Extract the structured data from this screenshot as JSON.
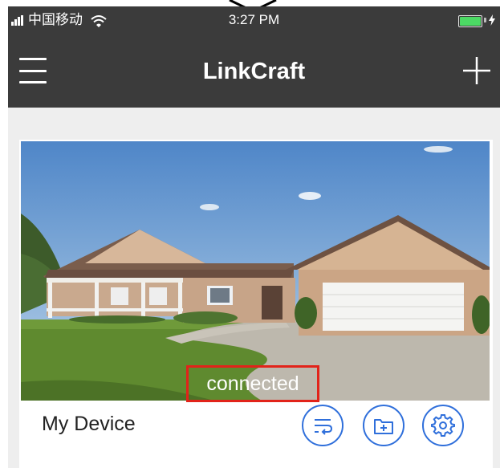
{
  "status_bar": {
    "carrier": "中国移动",
    "time": "3:27 PM"
  },
  "nav": {
    "title": "LinkCraft",
    "menu_icon": "hamburger-menu-icon",
    "add_icon": "plus-icon"
  },
  "device": {
    "name": "My Device",
    "status": "connected",
    "status_highlight_color": "#e2231a",
    "actions": [
      {
        "name": "playback",
        "icon": "playback-list-icon"
      },
      {
        "name": "files",
        "icon": "folder-add-icon"
      },
      {
        "name": "settings",
        "icon": "gear-icon"
      }
    ],
    "action_color": "#2f6fdb"
  },
  "colors": {
    "header_bg": "#3b3b3b",
    "content_bg": "#eeeeee"
  }
}
